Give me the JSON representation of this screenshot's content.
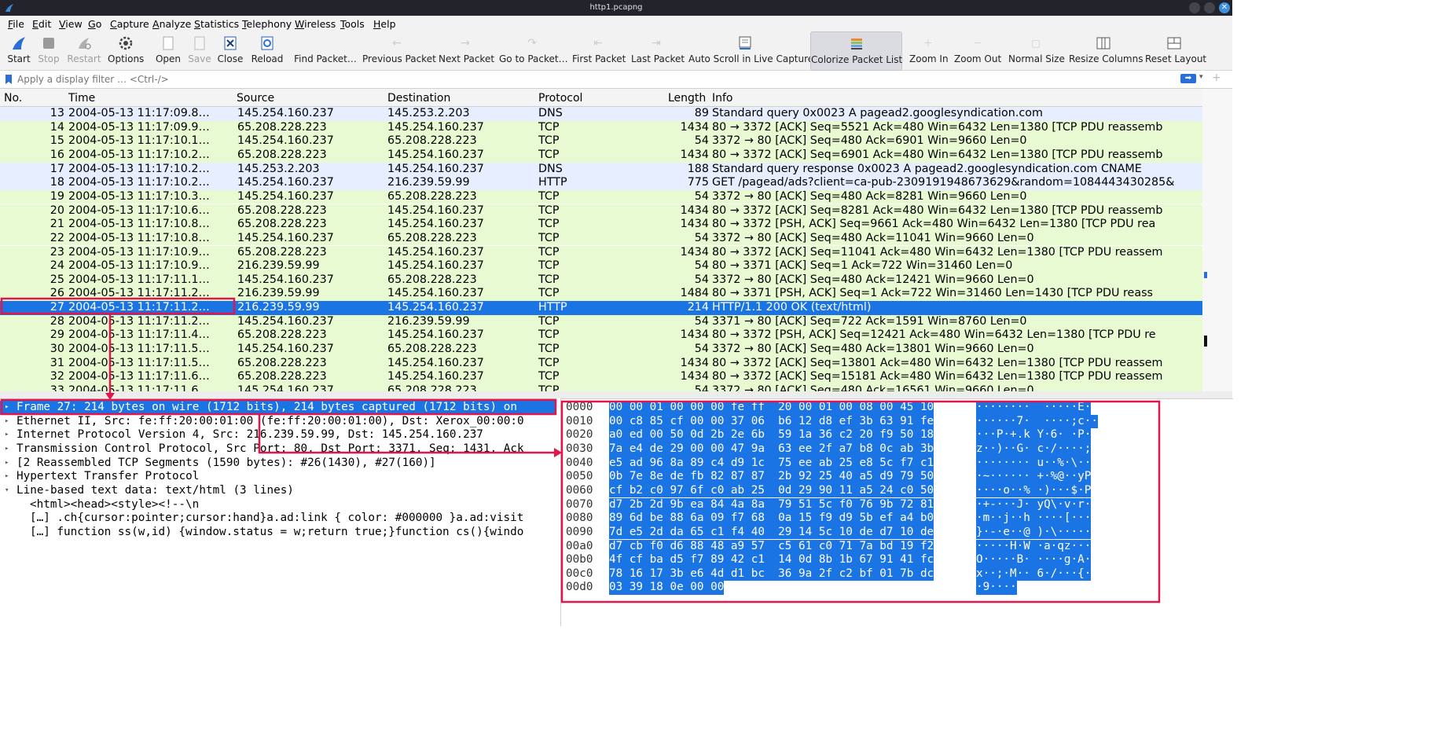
{
  "window": {
    "title": "http1.pcapng"
  },
  "menu": [
    "File",
    "Edit",
    "View",
    "Go",
    "Capture",
    "Analyze",
    "Statistics",
    "Telephony",
    "Wireless",
    "Tools",
    "Help"
  ],
  "toolbar": {
    "start": "Start",
    "stop": "Stop",
    "restart": "Restart",
    "options": "Options",
    "open": "Open",
    "save": "Save",
    "close": "Close",
    "reload": "Reload",
    "find": "Find Packet…",
    "prev": "Previous Packet",
    "next": "Next Packet",
    "goto": "Go to Packet…",
    "first": "First Packet",
    "last": "Last Packet",
    "autoscroll": "Auto Scroll in Live Capture",
    "colorize": "Colorize Packet List",
    "zoom_in": "Zoom In",
    "zoom_out": "Zoom Out",
    "normal_size": "Normal Size",
    "resize_cols": "Resize Columns",
    "reset_layout": "Reset Layout"
  },
  "filter": {
    "placeholder": "Apply a display filter … <Ctrl-/>"
  },
  "packet_list": {
    "columns": [
      "No.",
      "Time",
      "Source",
      "Destination",
      "Protocol",
      "Length",
      "Info"
    ],
    "selected_no": "27",
    "rows": [
      {
        "no": "13",
        "time": "2004-05-13 11:17:09.8…",
        "src": "145.254.160.237",
        "dst": "145.253.2.203",
        "proto": "DNS",
        "len": "89",
        "info": "Standard query 0x0023 A pagead2.googlesyndication.com"
      },
      {
        "no": "14",
        "time": "2004-05-13 11:17:09.9…",
        "src": "65.208.228.223",
        "dst": "145.254.160.237",
        "proto": "TCP",
        "len": "1434",
        "info": "80 → 3372 [ACK] Seq=5521 Ack=480 Win=6432 Len=1380 [TCP PDU reassemb"
      },
      {
        "no": "15",
        "time": "2004-05-13 11:17:10.1…",
        "src": "145.254.160.237",
        "dst": "65.208.228.223",
        "proto": "TCP",
        "len": "54",
        "info": "3372 → 80 [ACK] Seq=480 Ack=6901 Win=9660 Len=0"
      },
      {
        "no": "16",
        "time": "2004-05-13 11:17:10.2…",
        "src": "65.208.228.223",
        "dst": "145.254.160.237",
        "proto": "TCP",
        "len": "1434",
        "info": "80 → 3372 [ACK] Seq=6901 Ack=480 Win=6432 Len=1380 [TCP PDU reassemb"
      },
      {
        "no": "17",
        "time": "2004-05-13 11:17:10.2…",
        "src": "145.253.2.203",
        "dst": "145.254.160.237",
        "proto": "DNS",
        "len": "188",
        "info": "Standard query response 0x0023 A pagead2.googlesyndication.com CNAME"
      },
      {
        "no": "18",
        "time": "2004-05-13 11:17:10.2…",
        "src": "145.254.160.237",
        "dst": "216.239.59.99",
        "proto": "HTTP",
        "len": "775",
        "info": "GET /pagead/ads?client=ca-pub-2309191948673629&random=1084443430285&"
      },
      {
        "no": "19",
        "time": "2004-05-13 11:17:10.3…",
        "src": "145.254.160.237",
        "dst": "65.208.228.223",
        "proto": "TCP",
        "len": "54",
        "info": "3372 → 80 [ACK] Seq=480 Ack=8281 Win=9660 Len=0"
      },
      {
        "no": "20",
        "time": "2004-05-13 11:17:10.6…",
        "src": "65.208.228.223",
        "dst": "145.254.160.237",
        "proto": "TCP",
        "len": "1434",
        "info": "80 → 3372 [ACK] Seq=8281 Ack=480 Win=6432 Len=1380 [TCP PDU reassemb"
      },
      {
        "no": "21",
        "time": "2004-05-13 11:17:10.8…",
        "src": "65.208.228.223",
        "dst": "145.254.160.237",
        "proto": "TCP",
        "len": "1434",
        "info": "80 → 3372 [PSH, ACK] Seq=9661 Ack=480 Win=6432 Len=1380 [TCP PDU rea"
      },
      {
        "no": "22",
        "time": "2004-05-13 11:17:10.8…",
        "src": "145.254.160.237",
        "dst": "65.208.228.223",
        "proto": "TCP",
        "len": "54",
        "info": "3372 → 80 [ACK] Seq=480 Ack=11041 Win=9660 Len=0"
      },
      {
        "no": "23",
        "time": "2004-05-13 11:17:10.9…",
        "src": "65.208.228.223",
        "dst": "145.254.160.237",
        "proto": "TCP",
        "len": "1434",
        "info": "80 → 3372 [ACK] Seq=11041 Ack=480 Win=6432 Len=1380 [TCP PDU reassem"
      },
      {
        "no": "24",
        "time": "2004-05-13 11:17:10.9…",
        "src": "216.239.59.99",
        "dst": "145.254.160.237",
        "proto": "TCP",
        "len": "54",
        "info": "80 → 3371 [ACK] Seq=1 Ack=722 Win=31460 Len=0"
      },
      {
        "no": "25",
        "time": "2004-05-13 11:17:11.1…",
        "src": "145.254.160.237",
        "dst": "65.208.228.223",
        "proto": "TCP",
        "len": "54",
        "info": "3372 → 80 [ACK] Seq=480 Ack=12421 Win=9660 Len=0"
      },
      {
        "no": "26",
        "time": "2004-05-13 11:17:11.2…",
        "src": "216.239.59.99",
        "dst": "145.254.160.237",
        "proto": "TCP",
        "len": "1484",
        "info": "80 → 3371 [PSH, ACK] Seq=1 Ack=722 Win=31460 Len=1430 [TCP PDU reass"
      },
      {
        "no": "27",
        "time": "2004-05-13 11:17:11.2…",
        "src": "216.239.59.99",
        "dst": "145.254.160.237",
        "proto": "HTTP",
        "len": "214",
        "info": "HTTP/1.1 200 OK  (text/html)"
      },
      {
        "no": "28",
        "time": "2004-05-13 11:17:11.2…",
        "src": "145.254.160.237",
        "dst": "216.239.59.99",
        "proto": "TCP",
        "len": "54",
        "info": "3371 → 80 [ACK] Seq=722 Ack=1591 Win=8760 Len=0"
      },
      {
        "no": "29",
        "time": "2004-05-13 11:17:11.4…",
        "src": "65.208.228.223",
        "dst": "145.254.160.237",
        "proto": "TCP",
        "len": "1434",
        "info": "80 → 3372 [PSH, ACK] Seq=12421 Ack=480 Win=6432 Len=1380 [TCP PDU re"
      },
      {
        "no": "30",
        "time": "2004-05-13 11:17:11.5…",
        "src": "145.254.160.237",
        "dst": "65.208.228.223",
        "proto": "TCP",
        "len": "54",
        "info": "3372 → 80 [ACK] Seq=480 Ack=13801 Win=9660 Len=0"
      },
      {
        "no": "31",
        "time": "2004-05-13 11:17:11.5…",
        "src": "65.208.228.223",
        "dst": "145.254.160.237",
        "proto": "TCP",
        "len": "1434",
        "info": "80 → 3372 [ACK] Seq=13801 Ack=480 Win=6432 Len=1380 [TCP PDU reassem"
      },
      {
        "no": "32",
        "time": "2004-05-13 11:17:11.6…",
        "src": "65.208.228.223",
        "dst": "145.254.160.237",
        "proto": "TCP",
        "len": "1434",
        "info": "80 → 3372 [ACK] Seq=15181 Ack=480 Win=6432 Len=1380 [TCP PDU reassem"
      },
      {
        "no": "33",
        "time": "2004-05-13 11:17:11.6…",
        "src": "145.254.160.237",
        "dst": "65.208.228.223",
        "proto": "TCP",
        "len": "54",
        "info": "3372 → 80 [ACK] Seq=480 Ack=16561 Win=9660 Len=0"
      }
    ]
  },
  "details": [
    {
      "text": "Frame 27: 214 bytes on wire (1712 bits), 214 bytes captured (1712 bits) on",
      "expanded": false,
      "selected": true
    },
    {
      "text": "Ethernet II, Src: fe:ff:20:00:01:00 (fe:ff:20:00:01:00), Dst: Xerox_00:00:0",
      "expanded": false
    },
    {
      "text": "Internet Protocol Version 4, Src: 216.239.59.99, Dst: 145.254.160.237",
      "expanded": false
    },
    {
      "text": "Transmission Control Protocol, Src Port: 80, Dst Port: 3371, Seq: 1431, Ack",
      "expanded": false
    },
    {
      "text": "[2 Reassembled TCP Segments (1590 bytes): #26(1430), #27(160)]",
      "expanded": false
    },
    {
      "text": "Hypertext Transfer Protocol",
      "expanded": false
    },
    {
      "text": "Line-based text data: text/html (3 lines)",
      "expanded": true
    },
    {
      "text": "<html><head><style><!--\\n",
      "child": true
    },
    {
      "text": "[…] .ch{cursor:pointer;cursor:hand}a.ad:link { color: #000000 }a.ad:visit",
      "child": true
    },
    {
      "text": "[…] function ss(w,id) {window.status = w;return true;}function cs(){windo",
      "child": true
    }
  ],
  "bytes": [
    {
      "off": "0000",
      "hex": "00 00 01 00 00 00 fe ff  20 00 01 00 08 00 45 10",
      "ascii": "········  ·····E·"
    },
    {
      "off": "0010",
      "hex": "00 c8 85 cf 00 00 37 06  b6 12 d8 ef 3b 63 91 fe",
      "ascii": "······7·  ····;c··"
    },
    {
      "off": "0020",
      "hex": "a0 ed 00 50 0d 2b 2e 6b  59 1a 36 c2 20 f9 50 18",
      "ascii": "···P·+.k Y·6· ·P·"
    },
    {
      "off": "0030",
      "hex": "7a e4 de 29 00 00 47 9a  63 ee 2f a7 b8 0c ab 3b",
      "ascii": "z··)··G· c·/····;"
    },
    {
      "off": "0040",
      "hex": "e5 ad 96 8a 89 c4 d9 1c  75 ee ab 25 e8 5c f7 c1",
      "ascii": "········ u··%·\\··"
    },
    {
      "off": "0050",
      "hex": "0b 7e 8e de fb 82 87 87  2b 92 25 40 a5 d9 79 50",
      "ascii": "·~······ +·%@··yP"
    },
    {
      "off": "0060",
      "hex": "cf b2 c0 97 6f c0 ab 25  0d 29 90 11 a5 24 c0 50",
      "ascii": "····o··% ·)···$·P"
    },
    {
      "off": "0070",
      "hex": "d7 2b 2d 9b ea 84 4a 8a  79 51 5c f0 76 9b 72 81",
      "ascii": "·+-···J· yQ\\·v·r·"
    },
    {
      "off": "0080",
      "hex": "89 6d be 88 6a 09 f7 68  0a 15 f9 d9 5b ef a4 b0",
      "ascii": "·m··j··h ····[···"
    },
    {
      "off": "0090",
      "hex": "7d e5 2d da 65 c1 f4 40  29 14 5c 10 de d7 10 de",
      "ascii": "}·-·e··@ )·\\·····"
    },
    {
      "off": "00a0",
      "hex": "d7 cb f0 d6 88 48 a9 57  c5 61 c0 71 7a bd 19 f2",
      "ascii": "·····H·W ·a·qz···"
    },
    {
      "off": "00b0",
      "hex": "4f cf ba d5 f7 89 42 c1  14 0d 8b 1b 67 91 41 fc",
      "ascii": "O·····B· ····g·A·"
    },
    {
      "off": "00c0",
      "hex": "78 16 17 3b e6 4d d1 bc  36 9a 2f c2 bf 01 7b dc",
      "ascii": "x··;·M·· 6·/···{·"
    },
    {
      "off": "00d0",
      "hex": "03 39 18 0e 00 00",
      "ascii": "·9····"
    }
  ],
  "colors": {
    "tcp_row": "#e7fad1",
    "dns_row": "#e6eeff",
    "selected": "#1b74e4",
    "annotation": "#e0164c"
  }
}
